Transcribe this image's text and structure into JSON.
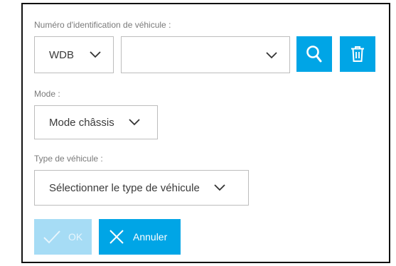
{
  "vin": {
    "label": "Numéro d'identification de véhicule :",
    "prefix_value": "WDB",
    "number_value": ""
  },
  "mode": {
    "label": "Mode :",
    "value": "Mode châssis"
  },
  "vehicle_type": {
    "label": "Type de véhicule :",
    "value": "Sélectionner le type de véhicule"
  },
  "actions": {
    "ok_label": "OK",
    "cancel_label": "Annuler"
  },
  "icons": {
    "search": "search-icon",
    "delete": "trash-icon",
    "ok": "check-icon",
    "cancel": "close-icon",
    "dropdown": "chevron-down-icon"
  },
  "colors": {
    "accent": "#00a5e6",
    "disabled_accent": "#a6dcf5",
    "border": "#bdbdbd",
    "label": "#7a7a7a"
  }
}
